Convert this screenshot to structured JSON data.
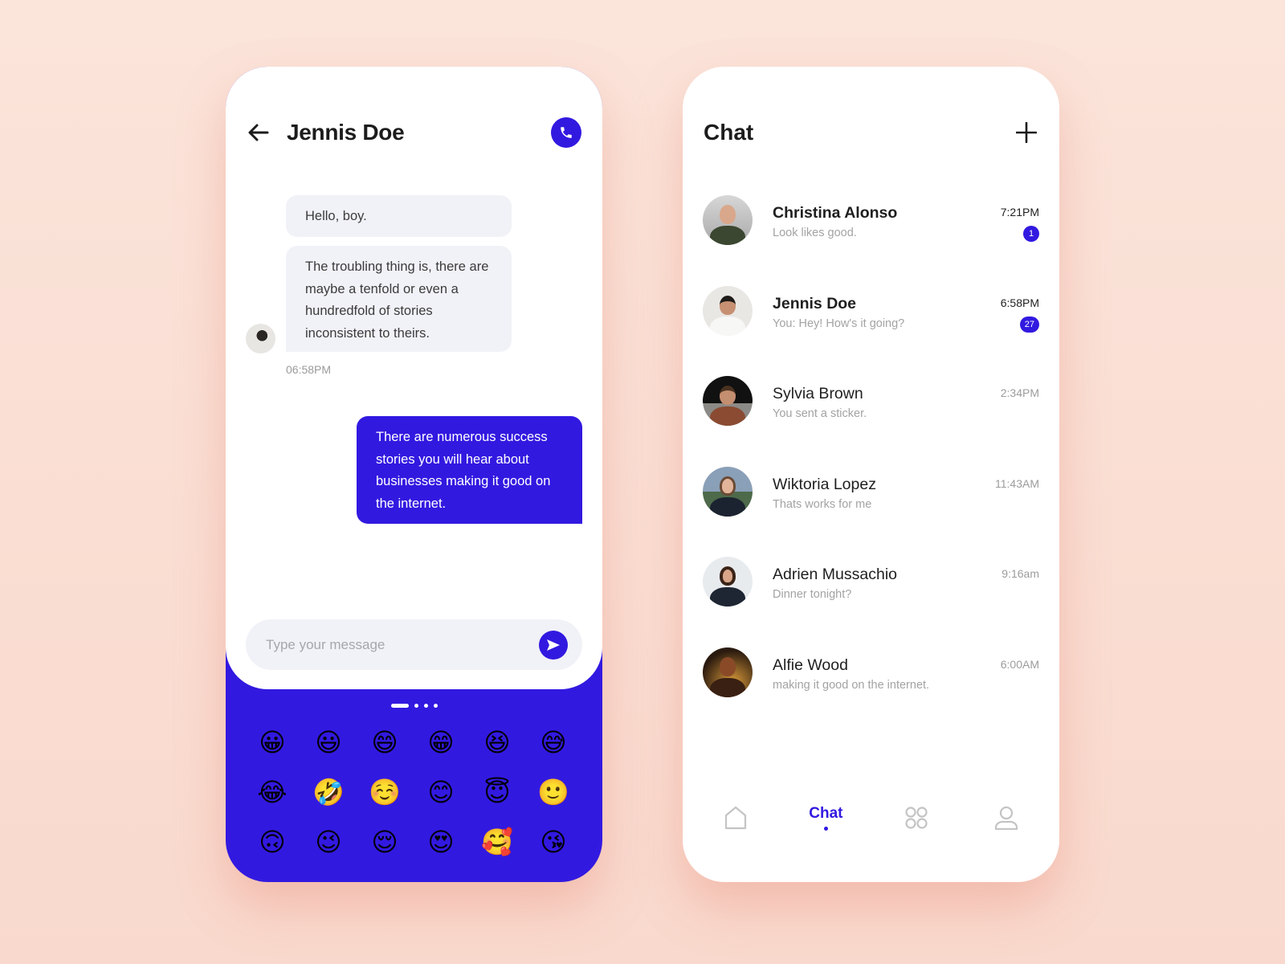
{
  "theme": {
    "accent": "#3219e0",
    "bubble_in_bg": "#f1f2f7",
    "background": "#fadfd5"
  },
  "conversation": {
    "title": "Jennis Doe",
    "back_icon": "arrow-left-icon",
    "call_icon": "phone-icon",
    "messages": [
      {
        "direction": "incoming",
        "text": "Hello, boy."
      },
      {
        "direction": "incoming",
        "text": "The troubling thing is, there are maybe a tenfold or even a hundredfold of stories inconsistent to theirs."
      },
      {
        "direction": "outgoing",
        "text": "There are numerous success stories you will hear about businesses making it good on the internet."
      }
    ],
    "incoming_timestamp": "06:58PM",
    "composer": {
      "placeholder": "Type your message",
      "value": "",
      "send_icon": "send-icon"
    },
    "emoji_keyboard": {
      "page_count": 4,
      "active_page": 1,
      "emojis": [
        "😀",
        "😃",
        "😄",
        "😁",
        "😆",
        "😅",
        "😂",
        "🤣",
        "☺️",
        "😊",
        "😇",
        "🙂",
        "🙃",
        "😉",
        "😌",
        "😍",
        "🥰",
        "😘"
      ]
    }
  },
  "chat_list": {
    "title": "Chat",
    "add_icon": "plus-icon",
    "items": [
      {
        "name": "Christina Alonso",
        "preview": "Look likes good.",
        "time": "7:21PM",
        "unread": true,
        "badge": "1"
      },
      {
        "name": "Jennis Doe",
        "preview": "You: Hey! How's it going?",
        "time": "6:58PM",
        "unread": true,
        "badge": "27"
      },
      {
        "name": "Sylvia Brown",
        "preview": "You sent a sticker.",
        "time": "2:34PM",
        "unread": false,
        "badge": null
      },
      {
        "name": "Wiktoria Lopez",
        "preview": "Thats works for me",
        "time": "11:43AM",
        "unread": false,
        "badge": null
      },
      {
        "name": "Adrien Mussachio",
        "preview": "Dinner tonight?",
        "time": "9:16am",
        "unread": false,
        "badge": null
      },
      {
        "name": "Alfie Wood",
        "preview": "making it good on the internet.",
        "time": "6:00AM",
        "unread": false,
        "badge": null
      }
    ],
    "tabbar": {
      "tabs": [
        {
          "id": "home",
          "icon": "home-icon",
          "label": ""
        },
        {
          "id": "chat",
          "icon": null,
          "label": "Chat",
          "active": true
        },
        {
          "id": "apps",
          "icon": "grid-icon",
          "label": ""
        },
        {
          "id": "profile",
          "icon": "user-icon",
          "label": ""
        }
      ]
    }
  }
}
